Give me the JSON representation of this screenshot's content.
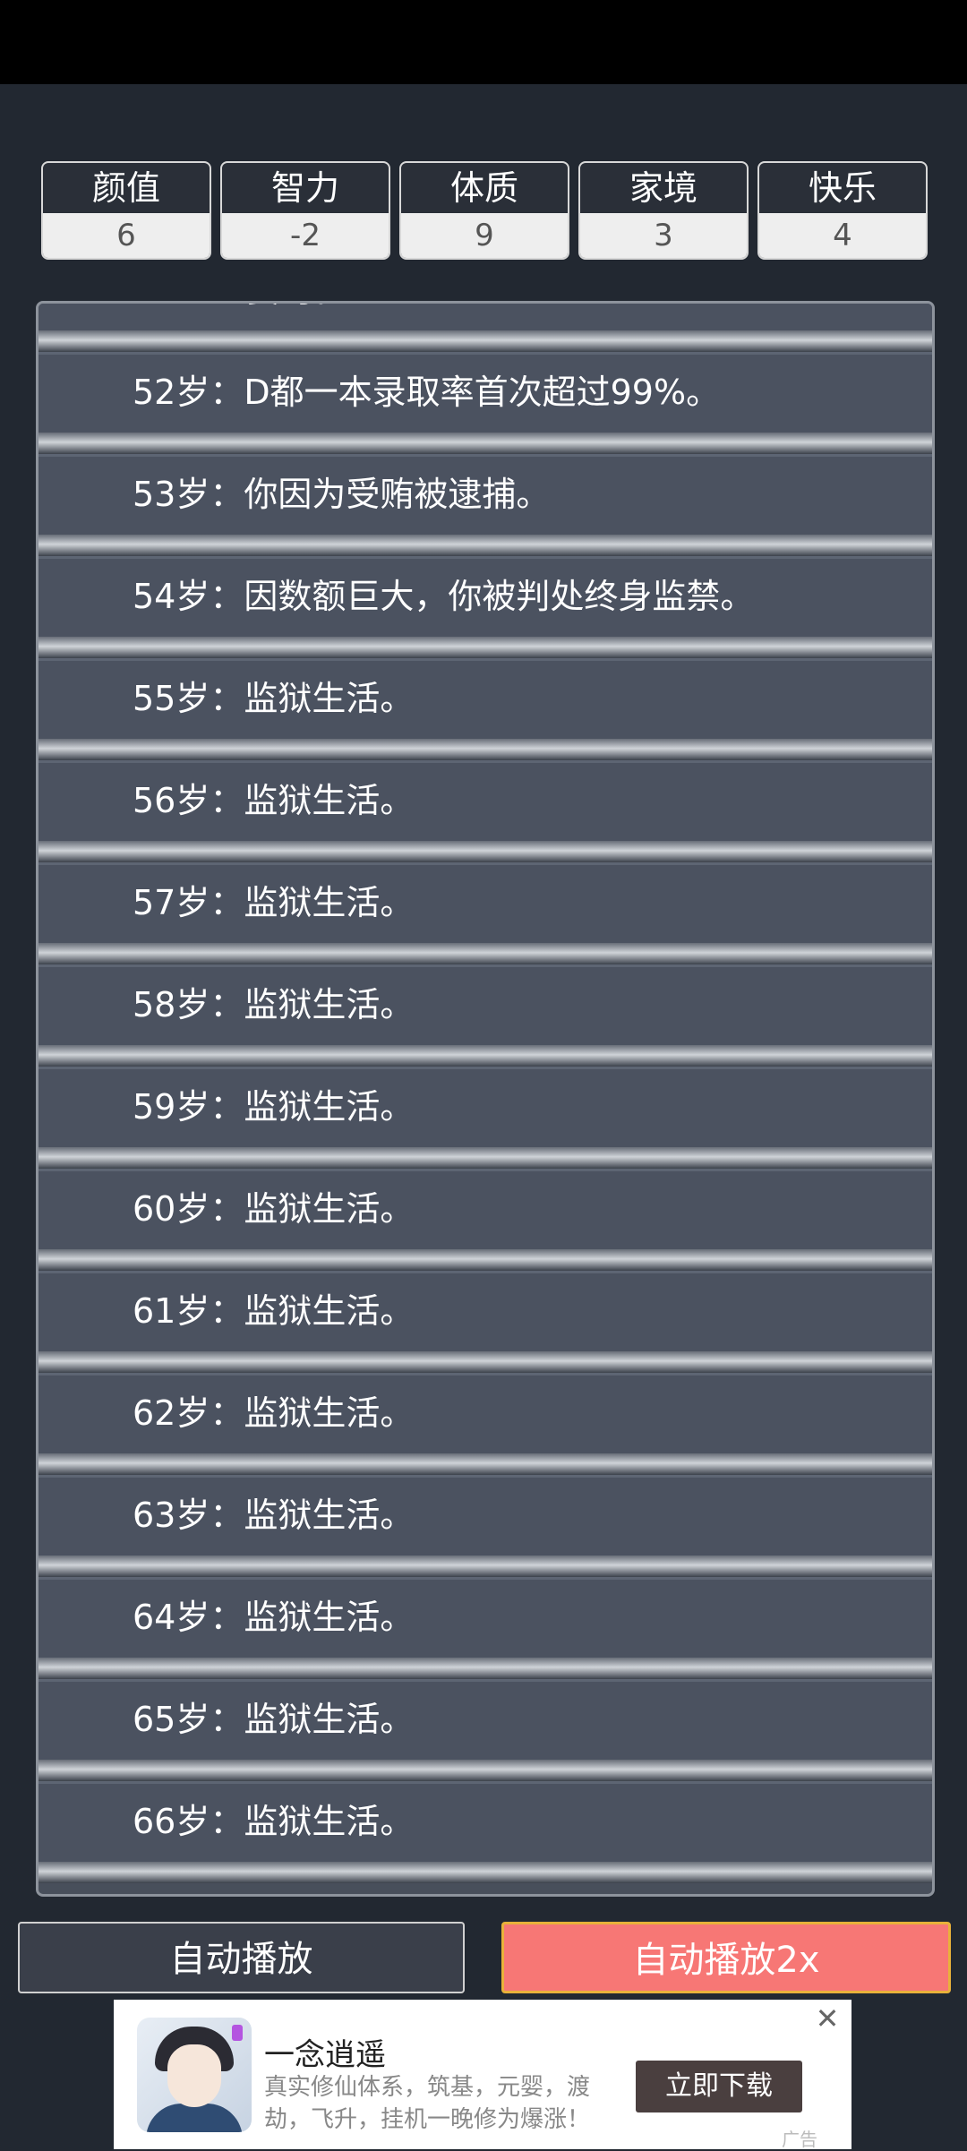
{
  "attributes": [
    {
      "label": "颜值",
      "value": "6"
    },
    {
      "label": "智力",
      "value": "-2"
    },
    {
      "label": "体质",
      "value": "9"
    },
    {
      "label": "家境",
      "value": "3"
    },
    {
      "label": "快乐",
      "value": "4"
    }
  ],
  "events": {
    "partial_top": "要时。",
    "items": [
      "52岁：D都一本录取率首次超过99%。",
      "53岁：你因为受贿被逮捕。",
      "54岁：因数额巨大，你被判处终身监禁。",
      "55岁：监狱生活。",
      "56岁：监狱生活。",
      "57岁：监狱生活。",
      "58岁：监狱生活。",
      "59岁：监狱生活。",
      "60岁：监狱生活。",
      "61岁：监狱生活。",
      "62岁：监狱生活。",
      "63岁：监狱生活。",
      "64岁：监狱生活。",
      "65岁：监狱生活。",
      "66岁：监狱生活。"
    ]
  },
  "buttons": {
    "auto_play": "自动播放",
    "auto_play_2x": "自动播放2x"
  },
  "ad": {
    "title": "一念逍遥",
    "description": "真实修仙体系，筑基，元婴，渡劫，飞升，挂机一晚修为爆涨！",
    "download_label": "立即下载",
    "close_icon": "close-icon",
    "tag": "广告"
  }
}
